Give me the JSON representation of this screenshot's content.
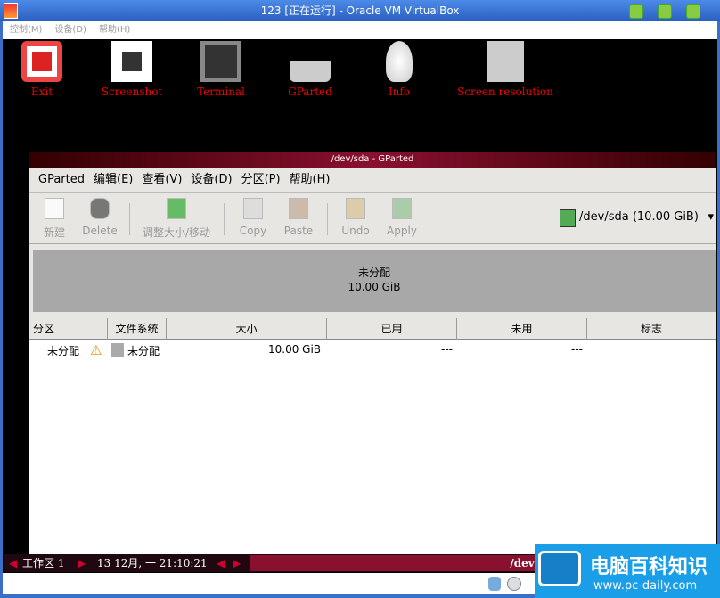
{
  "vbox": {
    "title": "123 [正在运行] - Oracle VM VirtualBox",
    "menu": [
      "控制(M)",
      "设备(D)",
      "帮助(H)"
    ]
  },
  "desktop": {
    "icons": [
      {
        "label": "Exit",
        "icon": "power-icon"
      },
      {
        "label": "Screenshot",
        "icon": "camera-icon"
      },
      {
        "label": "Terminal",
        "icon": "terminal-icon"
      },
      {
        "label": "GParted",
        "icon": "gparted-icon"
      },
      {
        "label": "Info",
        "icon": "lightbulb-icon"
      },
      {
        "label": "Screen resolution",
        "icon": "monitor-icon"
      }
    ]
  },
  "gparted": {
    "title": "/dev/sda - GParted",
    "menu": [
      "GParted",
      "编辑(E)",
      "查看(V)",
      "设备(D)",
      "分区(P)",
      "帮助(H)"
    ],
    "toolbar": {
      "new": "新建",
      "delete": "Delete",
      "resize": "调整大小/移动",
      "copy": "Copy",
      "paste": "Paste",
      "undo": "Undo",
      "apply": "Apply"
    },
    "device": "/dev/sda  (10.00 GiB)",
    "graph": {
      "label": "未分配",
      "size": "10.00 GiB"
    },
    "columns": [
      "分区",
      "文件系统",
      "大小",
      "已用",
      "未用",
      "标志"
    ],
    "rows": [
      {
        "partition": "未分配",
        "filesystem": "未分配",
        "size": "10.00 GiB",
        "used": "---",
        "unused": "---",
        "flags": ""
      }
    ]
  },
  "taskbar": {
    "workspace": "工作区 1",
    "clock": "13 12月, 一 21:10:21",
    "task": "/dev/sda - GParted"
  },
  "watermark": {
    "name": "电脑百科知识",
    "url": "www.pc-daily.com"
  }
}
